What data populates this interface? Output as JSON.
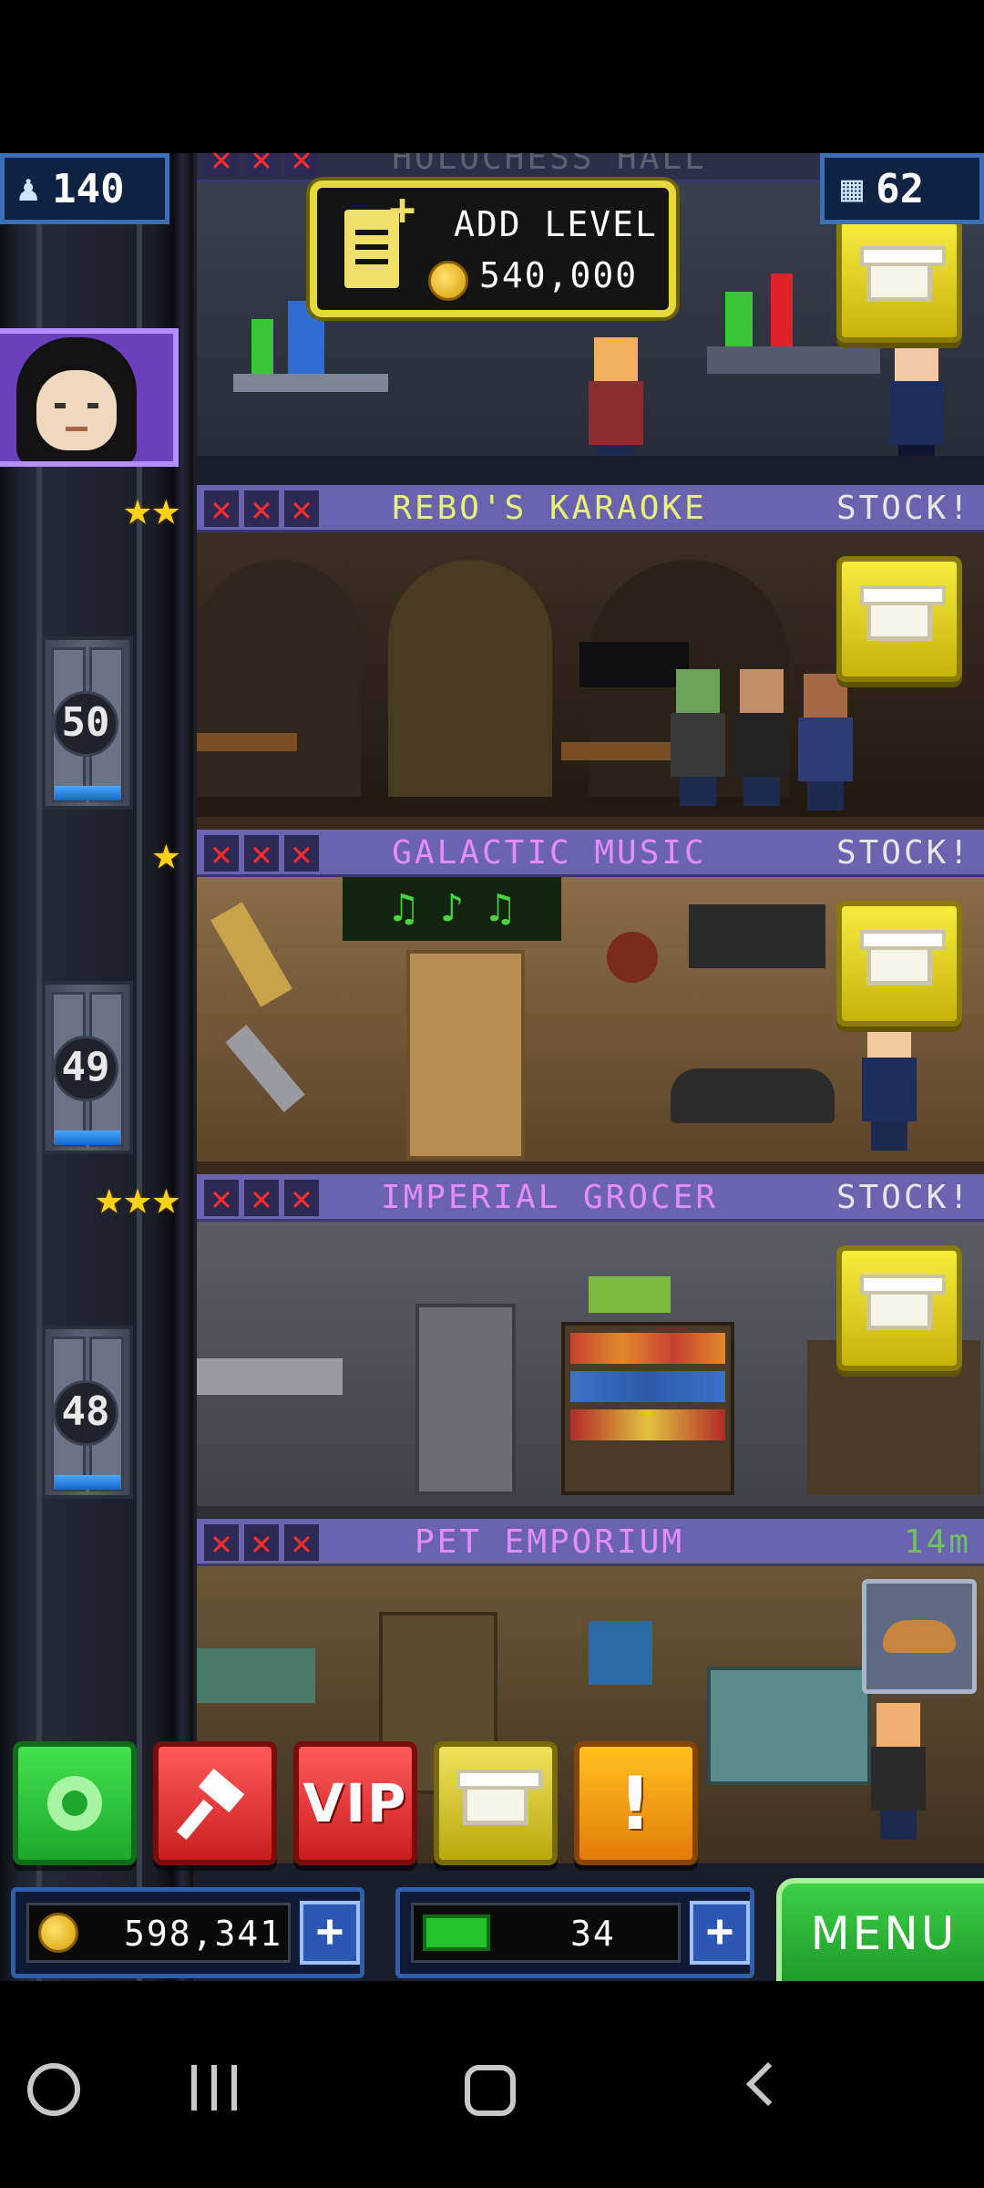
{
  "top_counters": {
    "population": "140",
    "floors": "62"
  },
  "add_level": {
    "label": "ADD LEVEL",
    "cost": "540,000"
  },
  "floors": [
    {
      "name": "HOLOCHESS HALL",
      "status": "",
      "name_color": "#ffffff"
    },
    {
      "name": "REBO'S KARAOKE",
      "status": "STOCK!",
      "name_color": "#e8f07a"
    },
    {
      "name": "GALACTIC MUSIC",
      "status": "STOCK!",
      "name_color": "#e48cff"
    },
    {
      "name": "IMPERIAL GROCER",
      "status": "STOCK!",
      "name_color": "#e48cff"
    },
    {
      "name": "PET EMPORIUM",
      "status": "14m",
      "name_color": "#e48cff"
    }
  ],
  "elevator_floor_numbers": [
    "50",
    "49",
    "48"
  ],
  "actions": {
    "vip_label": "VIP",
    "alert_label": "!"
  },
  "currency": {
    "coins": "598,341",
    "bux": "34"
  },
  "menu_label": "MENU",
  "colors": {
    "floor_header": "#6a64b0",
    "stock_button": "#f6ec3a",
    "menu": "#3cd046",
    "coin": "#ffcf2a"
  }
}
